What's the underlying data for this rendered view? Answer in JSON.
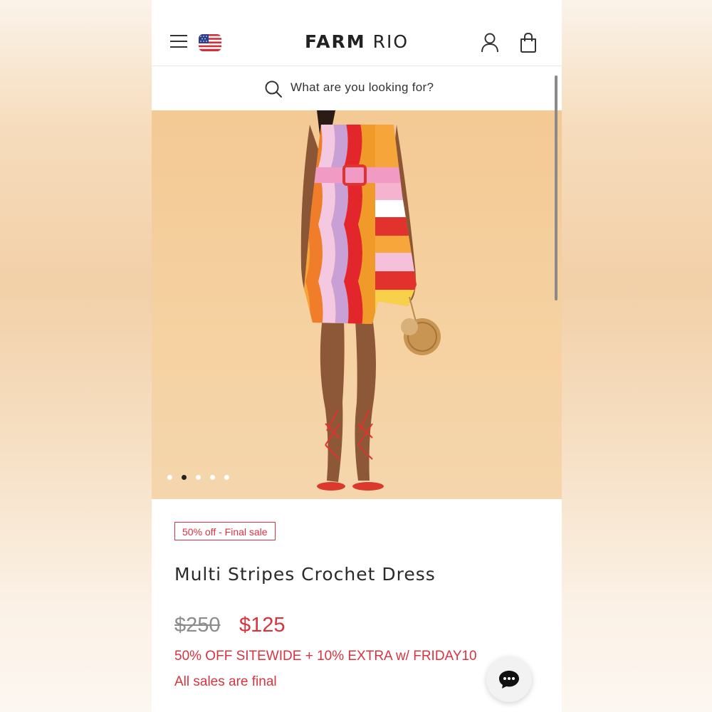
{
  "header": {
    "logo_part1": "FARM",
    "logo_part2": "RIO",
    "menu_icon": "hamburger-menu-icon",
    "flag_icon": "us-flag-icon",
    "account_icon": "user-icon",
    "bag_icon": "shopping-bag-icon"
  },
  "search": {
    "placeholder": "What are you looking for?",
    "icon": "search-icon"
  },
  "gallery": {
    "dot_count": 5,
    "active_index": 1
  },
  "product": {
    "badge": "50% off - Final sale",
    "title": "Multi Stripes Crochet Dress",
    "original_price": "$250",
    "sale_price": "$125",
    "promo": "50% OFF SITEWIDE + 10% EXTRA w/ FRIDAY10",
    "final_note": "All sales are final"
  },
  "chat": {
    "icon": "chat-bubble-icon"
  },
  "colors": {
    "accent_red": "#d9333f",
    "text_dark": "#2a2a2a",
    "muted": "#8c8c8c",
    "hero_background": "#f4cf9e"
  }
}
